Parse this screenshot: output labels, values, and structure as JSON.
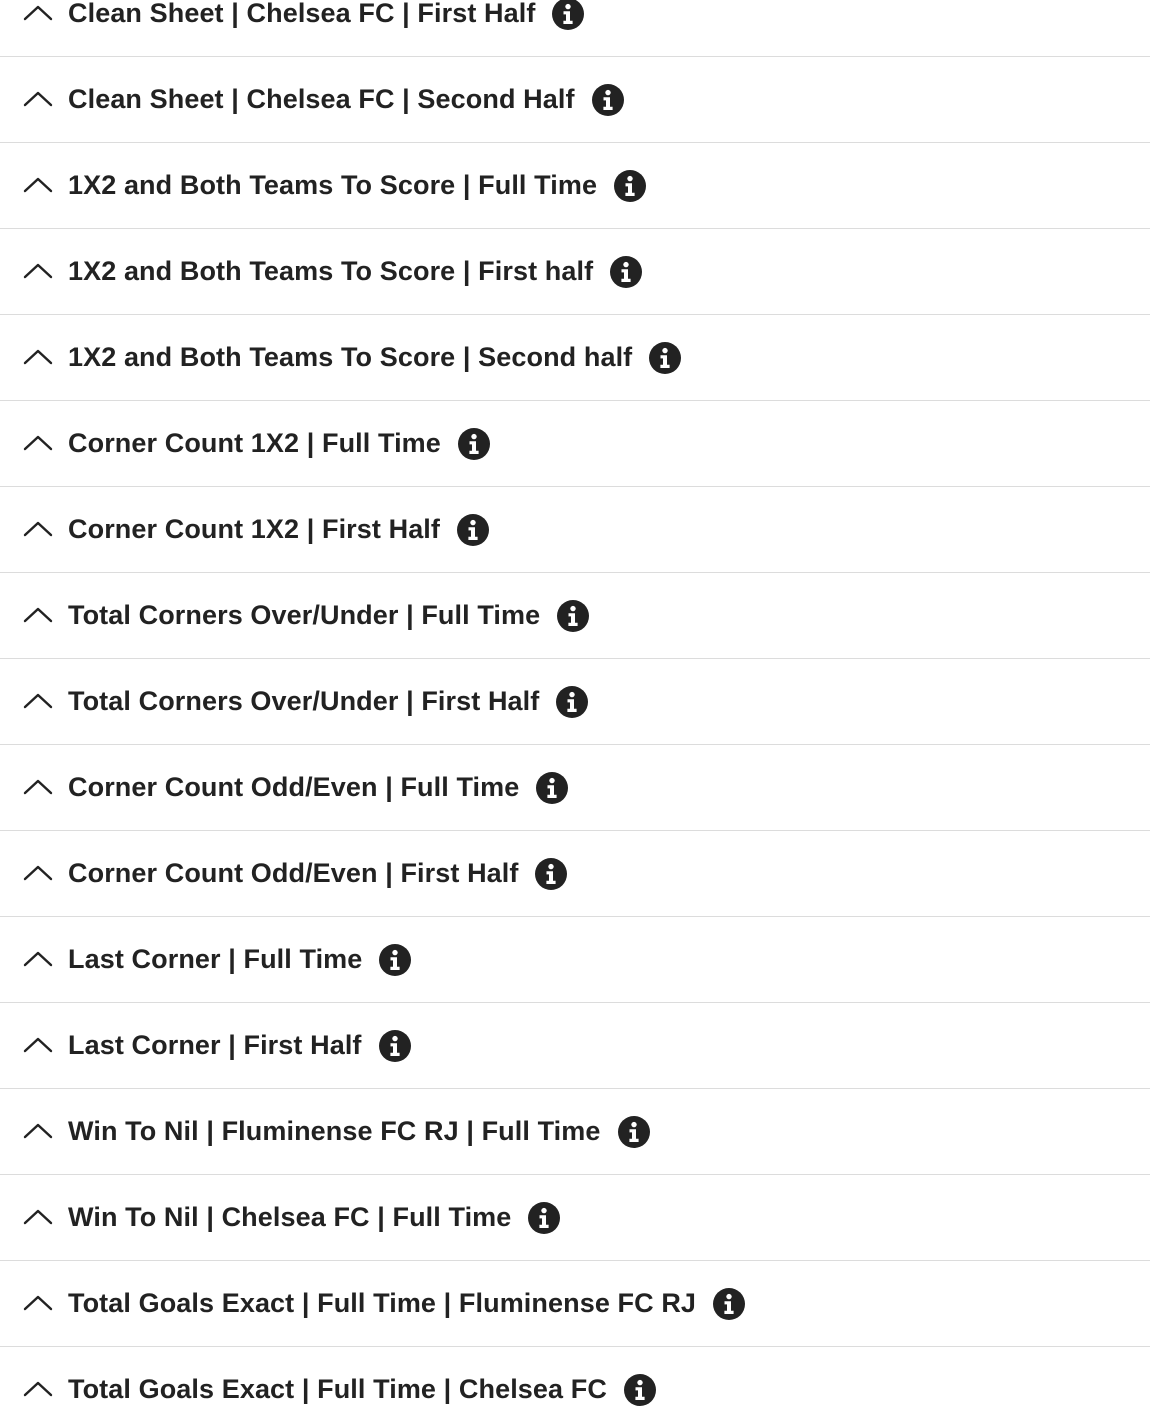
{
  "markets": [
    {
      "title": "Clean Sheet | Chelsea FC | First Half",
      "icon": "chevron-up-icon",
      "info_icon": "info-icon"
    },
    {
      "title": "Clean Sheet | Chelsea FC | Second Half",
      "icon": "chevron-up-icon",
      "info_icon": "info-icon"
    },
    {
      "title": "1X2 and Both Teams To Score | Full Time",
      "icon": "chevron-up-icon",
      "info_icon": "info-icon"
    },
    {
      "title": "1X2 and Both Teams To Score | First half",
      "icon": "chevron-up-icon",
      "info_icon": "info-icon"
    },
    {
      "title": "1X2 and Both Teams To Score | Second half",
      "icon": "chevron-up-icon",
      "info_icon": "info-icon"
    },
    {
      "title": "Corner Count 1X2 | Full Time",
      "icon": "chevron-up-icon",
      "info_icon": "info-icon"
    },
    {
      "title": "Corner Count 1X2 | First Half",
      "icon": "chevron-up-icon",
      "info_icon": "info-icon"
    },
    {
      "title": "Total Corners Over/Under | Full Time",
      "icon": "chevron-up-icon",
      "info_icon": "info-icon"
    },
    {
      "title": "Total Corners Over/Under | First Half",
      "icon": "chevron-up-icon",
      "info_icon": "info-icon"
    },
    {
      "title": "Corner Count Odd/Even | Full Time",
      "icon": "chevron-up-icon",
      "info_icon": "info-icon"
    },
    {
      "title": "Corner Count Odd/Even | First Half",
      "icon": "chevron-up-icon",
      "info_icon": "info-icon"
    },
    {
      "title": "Last Corner | Full Time",
      "icon": "chevron-up-icon",
      "info_icon": "info-icon"
    },
    {
      "title": "Last Corner | First Half",
      "icon": "chevron-up-icon",
      "info_icon": "info-icon"
    },
    {
      "title": "Win To Nil | Fluminense FC RJ | Full Time",
      "icon": "chevron-up-icon",
      "info_icon": "info-icon"
    },
    {
      "title": "Win To Nil | Chelsea FC | Full Time",
      "icon": "chevron-up-icon",
      "info_icon": "info-icon"
    },
    {
      "title": "Total Goals Exact | Full Time | Fluminense FC RJ",
      "icon": "chevron-up-icon",
      "info_icon": "info-icon"
    },
    {
      "title": "Total Goals Exact | Full Time | Chelsea FC",
      "icon": "chevron-up-icon",
      "info_icon": "info-icon"
    }
  ],
  "colors": {
    "text": "#222222",
    "divider": "#dcdcdc",
    "background": "#ffffff"
  }
}
